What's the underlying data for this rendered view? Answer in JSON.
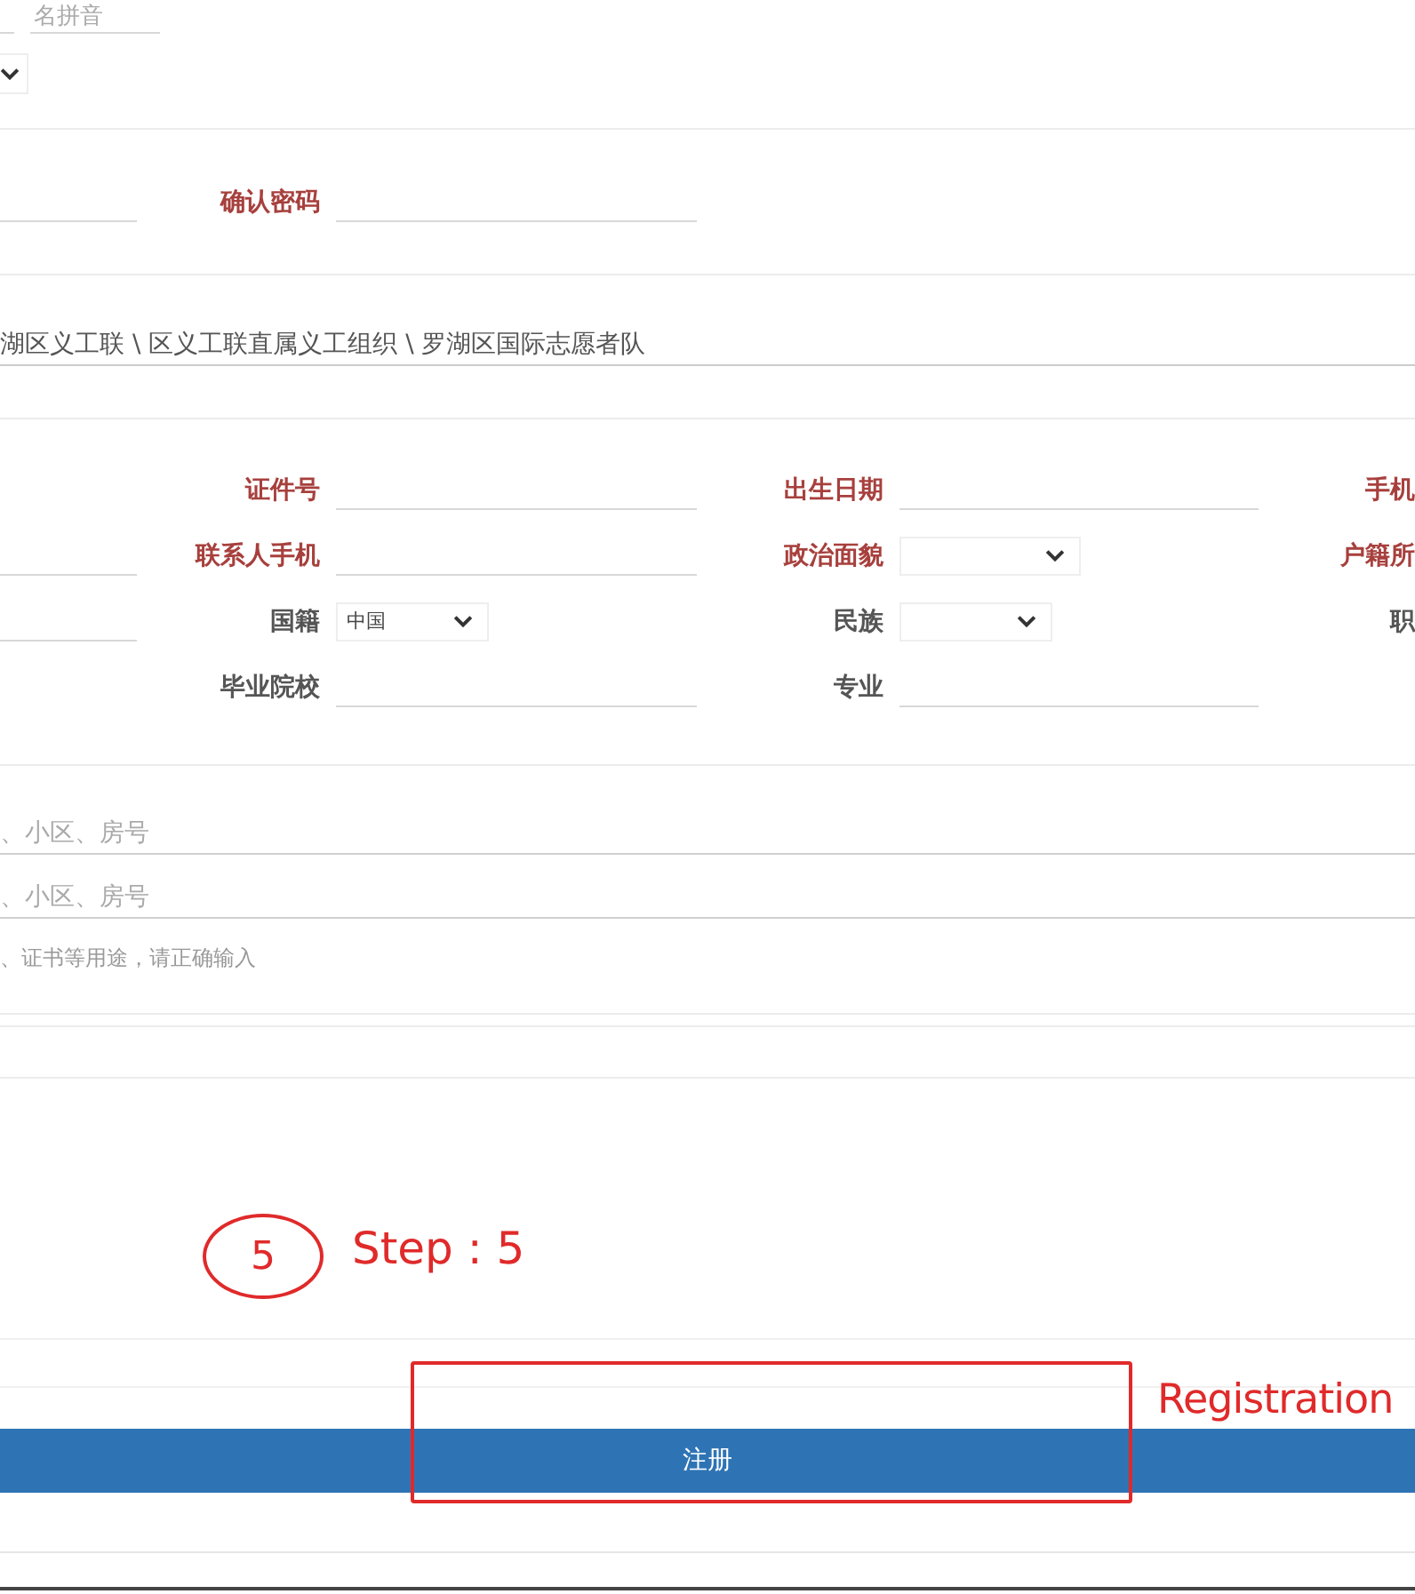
{
  "name_pinyin_field": {
    "placeholder": "名拼音"
  },
  "password_row": {
    "label": "确认密码",
    "required": true
  },
  "organization_path": "湖区义工联 \\ 区义工联直属义工组织 \\ 罗湖区国际志愿者队",
  "details_rows": [
    {
      "cells": [
        {
          "kind": "none"
        },
        {
          "label": "证件号",
          "required": true,
          "kind": "input"
        },
        {
          "label": "出生日期",
          "required": true,
          "kind": "input"
        },
        {
          "label": "手机",
          "required": true
        }
      ]
    },
    {
      "cells": [
        {
          "kind": "input"
        },
        {
          "label": "联系人手机",
          "required": true,
          "kind": "input"
        },
        {
          "label": "政治面貌",
          "required": true,
          "kind": "select"
        },
        {
          "label": "户籍所",
          "required": true
        }
      ]
    },
    {
      "cells": [
        {
          "kind": "input"
        },
        {
          "label": "国籍",
          "required": false,
          "kind": "select",
          "value": "中国"
        },
        {
          "label": "民族",
          "required": false,
          "kind": "select"
        },
        {
          "label": "职",
          "required": false
        }
      ]
    },
    {
      "cells": [
        {
          "kind": "none"
        },
        {
          "label": "毕业院校",
          "required": false,
          "kind": "input"
        },
        {
          "label": "专业",
          "required": false,
          "kind": "input"
        },
        {}
      ]
    }
  ],
  "address_fields": [
    {
      "placeholder": "、小区、房号"
    },
    {
      "placeholder": "、小区、房号"
    }
  ],
  "note_field": {
    "placeholder": "、证书等用途，请正确输入"
  },
  "step_annotation": {
    "number": "5",
    "caption": "Step : 5"
  },
  "submit_button": {
    "label": "注册"
  },
  "registration_annotation": {
    "caption": "Registration"
  }
}
